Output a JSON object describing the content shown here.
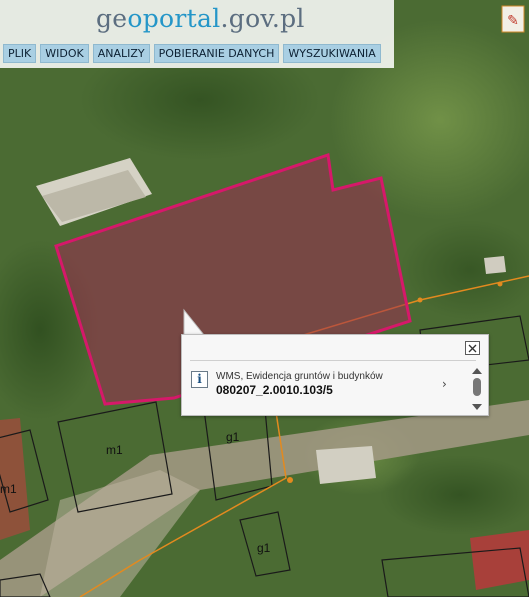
{
  "logo": {
    "part1": "ge",
    "part2": "oportal",
    "part3": ".gov.pl"
  },
  "menu": [
    "PLIK",
    "WIDOK",
    "ANALIZY",
    "POBIERANIE DANYCH",
    "WYSZUKIWANIA"
  ],
  "popup": {
    "layer": "WMS, Ewidencja gruntów i budynków",
    "parcel_id": "080207_2.0010.103/5"
  },
  "map": {
    "building_labels": {
      "m1": "m1",
      "g1a": "g1",
      "g1b": "g1",
      "m1edge": "m1"
    },
    "colors": {
      "parcel_stroke": "#d6186a",
      "parcel_fill": "#9c2b52",
      "utility_line": "#e38a1f",
      "building_outline": "#1a1a1a"
    }
  }
}
